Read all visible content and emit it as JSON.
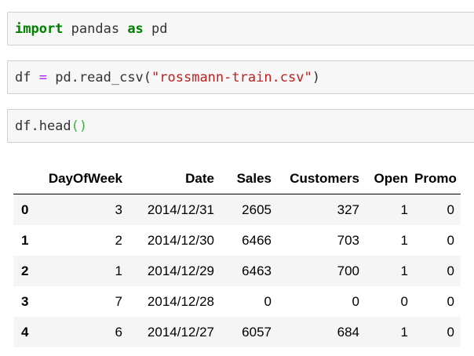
{
  "cells": [
    {
      "tokens": [
        {
          "text": "import",
          "kind": "kw"
        },
        {
          "text": " pandas ",
          "kind": "plain"
        },
        {
          "text": "as",
          "kind": "kw"
        },
        {
          "text": " pd",
          "kind": "plain"
        }
      ]
    },
    {
      "tokens": [
        {
          "text": "df ",
          "kind": "plain"
        },
        {
          "text": "=",
          "kind": "op"
        },
        {
          "text": " pd.read_csv(",
          "kind": "plain"
        },
        {
          "text": "\"rossmann-train.csv\"",
          "kind": "str"
        },
        {
          "text": ")",
          "kind": "plain"
        }
      ]
    },
    {
      "tokens": [
        {
          "text": "df.head",
          "kind": "plain"
        },
        {
          "text": "()",
          "kind": "paren-hl"
        }
      ]
    }
  ],
  "table": {
    "columns": [
      "",
      "DayOfWeek",
      "Date",
      "Sales",
      "Customers",
      "Open",
      "Promo"
    ],
    "rows": [
      [
        "0",
        "3",
        "2014/12/31",
        "2605",
        "327",
        "1",
        "0"
      ],
      [
        "1",
        "2",
        "2014/12/30",
        "6466",
        "703",
        "1",
        "0"
      ],
      [
        "2",
        "1",
        "2014/12/29",
        "6463",
        "700",
        "1",
        "0"
      ],
      [
        "3",
        "7",
        "2014/12/28",
        "0",
        "0",
        "0",
        "0"
      ],
      [
        "4",
        "6",
        "2014/12/27",
        "6057",
        "684",
        "1",
        "0"
      ]
    ]
  }
}
